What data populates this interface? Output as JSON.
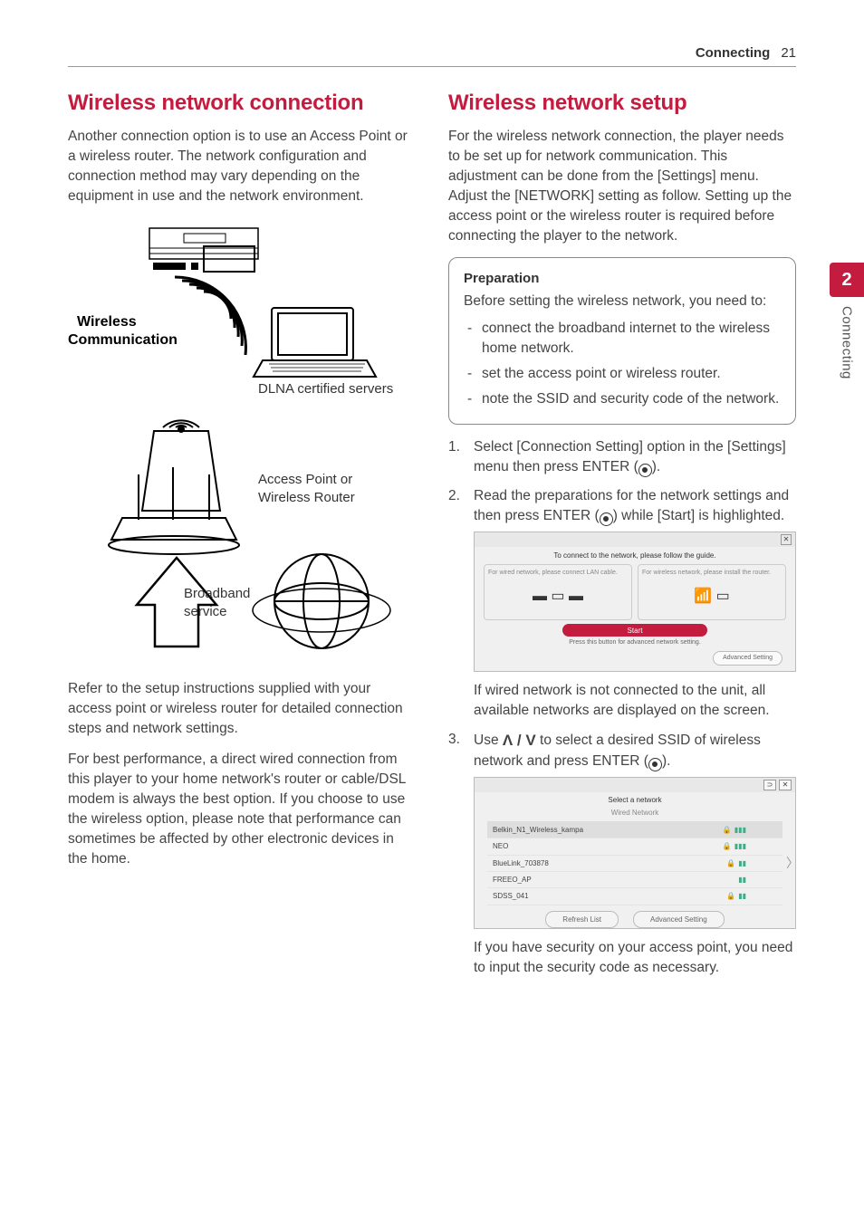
{
  "header": {
    "section": "Connecting",
    "page": "21"
  },
  "sideTab": {
    "number": "2",
    "label": "Connecting"
  },
  "col1": {
    "heading": "Wireless network connection",
    "intro": "Another connection option is to use an Access Point or a wireless router. The network configuration and connection method may vary depending on the equipment in use and the network environment.",
    "diagram": {
      "wirelessComm": "Wireless Communication",
      "dlna": "DLNA certified servers",
      "ap": "Access Point or Wireless Router",
      "broadband": "Broadband service"
    },
    "p2": "Refer to the setup instructions supplied with your access point or wireless router for detailed connection steps and network settings.",
    "p3": "For best performance, a direct wired connection from this player to your home network's router or cable/DSL modem is always the best option. If you choose to use the wireless option, please note that performance can sometimes be affected by other electronic devices in the home."
  },
  "col2": {
    "heading": "Wireless network setup",
    "intro": "For the wireless network connection, the player needs to be set up for network communication. This adjustment can be done from the [Settings] menu. Adjust the [NETWORK] setting as follow. Setting up the access point or the wireless router is required before connecting the player to the network.",
    "prep": {
      "title": "Preparation",
      "lead": "Before setting the wireless network, you need to:",
      "items": [
        "connect the broadband internet to the wireless home network.",
        "set the access point or wireless router.",
        "note the SSID and security code of the network."
      ]
    },
    "step1": "Select [Connection Setting] option in the [Settings] menu then press ENTER (",
    "step1b": ").",
    "step2": "Read the preparations for the network settings and then press ENTER (",
    "step2b": ") while [Start] is highlighted.",
    "ss1": {
      "title": "To connect to the network, please follow the guide.",
      "paneL": "For wired network, please connect LAN cable.",
      "paneR": "For wireless network, please install the router.",
      "start": "Start",
      "note": "Press this button for advanced network setting.",
      "adv": "Advanced Setting"
    },
    "afterSs1": "If wired network is not connected to the unit, all available networks are displayed on the screen.",
    "step3a": "Use ",
    "step3b": " to select a desired SSID of wireless network and press ENTER (",
    "step3c": ").",
    "ss2": {
      "title": "Select a network",
      "wired": "Wired Network",
      "rows": [
        {
          "name": "Belkin_N1_Wireless_kampa",
          "lock": true
        },
        {
          "name": "NEO",
          "lock": true
        },
        {
          "name": "BlueLink_703878",
          "lock": true
        },
        {
          "name": "FREEO_AP",
          "lock": false
        },
        {
          "name": "SDSS_041",
          "lock": true
        }
      ],
      "refresh": "Refresh List",
      "adv": "Advanced Setting"
    },
    "afterSs2": "If you have security on your access point, you need to input the security code as necessary."
  }
}
